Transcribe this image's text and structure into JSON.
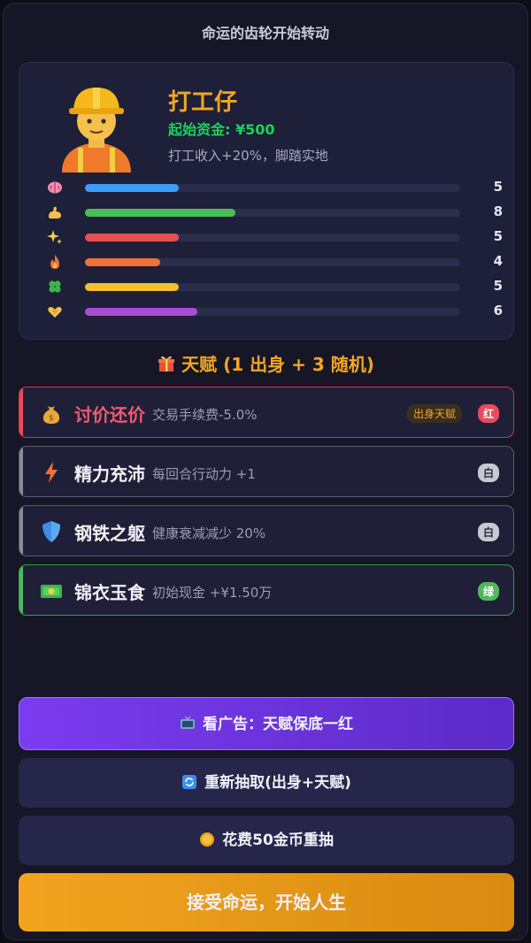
{
  "header": {
    "title": "命运的齿轮开始转动"
  },
  "character": {
    "name": "打工仔",
    "fund": "起始资金: ¥500",
    "desc": "打工收入+20%，脚踏实地",
    "stats": [
      {
        "icon": "brain-icon",
        "value": "5",
        "fill": 0.25,
        "color": "#3d9cf5"
      },
      {
        "icon": "muscle-icon",
        "value": "8",
        "fill": 0.4,
        "color": "#4cbb5a"
      },
      {
        "icon": "sparkles-icon",
        "value": "5",
        "fill": 0.25,
        "color": "#e94f4f"
      },
      {
        "icon": "fire-icon",
        "value": "4",
        "fill": 0.2,
        "color": "#f07036"
      },
      {
        "icon": "clover-icon",
        "value": "5",
        "fill": 0.25,
        "color": "#f2c12e"
      },
      {
        "icon": "heart-hands-icon",
        "value": "6",
        "fill": 0.3,
        "color": "#a44fd4"
      }
    ]
  },
  "talents": {
    "header": "天赋 (1 出身 + 3 随机)",
    "items": [
      {
        "name": "讨价还价",
        "desc": "交易手续费-5.0%",
        "origin_tag": "出身天赋",
        "badge": "红",
        "icon": "money-bag-icon"
      },
      {
        "name": "精力充沛",
        "desc": "每回合行动力 +1",
        "badge": "白",
        "icon": "lightning-icon"
      },
      {
        "name": "钢铁之躯",
        "desc": "健康衰减减少 20%",
        "badge": "白",
        "icon": "shield-icon"
      },
      {
        "name": "锦衣玉食",
        "desc": "初始现金 +¥1.50万",
        "badge": "绿",
        "icon": "banknote-icon"
      }
    ]
  },
  "buttons": {
    "watch_ad": "看广告：天赋保底一红",
    "redraw": "重新抽取(出身+天赋)",
    "coin_redraw": "花费50金币重抽",
    "accept": "接受命运，开始人生"
  },
  "colors": {
    "accent": "#f5a623",
    "red": "#e84a5f",
    "white": "#c0c0c8",
    "green": "#4cbb5a"
  }
}
